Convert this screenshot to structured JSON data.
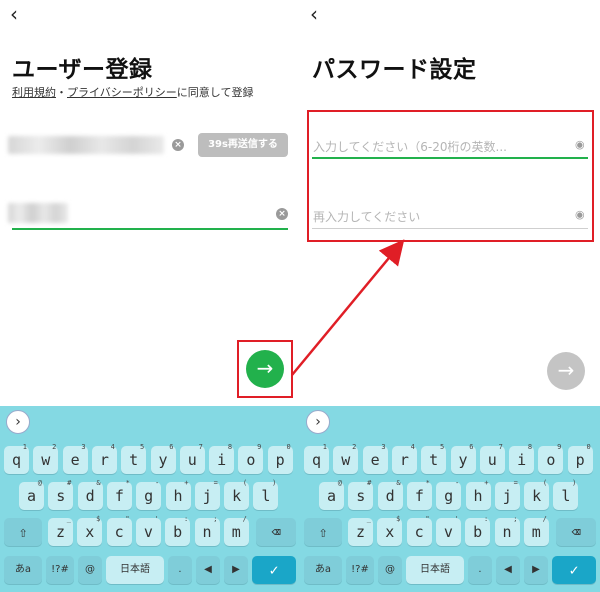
{
  "left": {
    "back_icon": "chevron-left",
    "title": "ユーザー登録",
    "terms": {
      "link1": "利用規約",
      "sep": "・",
      "link2": "プライバシーポリシー",
      "suffix": "に同意して登録"
    },
    "resend_label": "39s再送信する",
    "next_icon": "→"
  },
  "right": {
    "back_icon": "chevron-left",
    "title": "パスワード設定",
    "password_placeholder": "入力してください（6-20桁の英数...",
    "confirm_placeholder": "再入力してください",
    "next_icon": "→"
  },
  "keyboard": {
    "expand_icon": "›",
    "row1": [
      {
        "k": "q",
        "s": "1"
      },
      {
        "k": "w",
        "s": "2"
      },
      {
        "k": "e",
        "s": "3"
      },
      {
        "k": "r",
        "s": "4"
      },
      {
        "k": "t",
        "s": "5"
      },
      {
        "k": "y",
        "s": "6"
      },
      {
        "k": "u",
        "s": "7"
      },
      {
        "k": "i",
        "s": "8"
      },
      {
        "k": "o",
        "s": "9"
      },
      {
        "k": "p",
        "s": "0"
      }
    ],
    "row2": [
      {
        "k": "a",
        "s": "@"
      },
      {
        "k": "s",
        "s": "#"
      },
      {
        "k": "d",
        "s": "&"
      },
      {
        "k": "f",
        "s": "*"
      },
      {
        "k": "g",
        "s": "-"
      },
      {
        "k": "h",
        "s": "+"
      },
      {
        "k": "j",
        "s": "="
      },
      {
        "k": "k",
        "s": "("
      },
      {
        "k": "l",
        "s": ")"
      }
    ],
    "row3": [
      {
        "k": "z",
        "s": "_"
      },
      {
        "k": "x",
        "s": "$"
      },
      {
        "k": "c",
        "s": "\""
      },
      {
        "k": "v",
        "s": "'"
      },
      {
        "k": "b",
        "s": ":"
      },
      {
        "k": "n",
        "s": ";"
      },
      {
        "k": "m",
        "s": "/"
      }
    ],
    "shift_icon": "⇧",
    "backspace_icon": "⌫",
    "mode_key": "あa",
    "symbols_key": "!?#",
    "at_key": "@",
    "lang_key": "日本語",
    "period_key": ".",
    "left_key": "◀",
    "right_key": "▶",
    "enter_icon": "✓"
  },
  "colors": {
    "accent_green": "#22b14c",
    "highlight_red": "#e01e26",
    "keyboard_bg": "#84d9e3",
    "enter_blue": "#1aa6c8"
  }
}
